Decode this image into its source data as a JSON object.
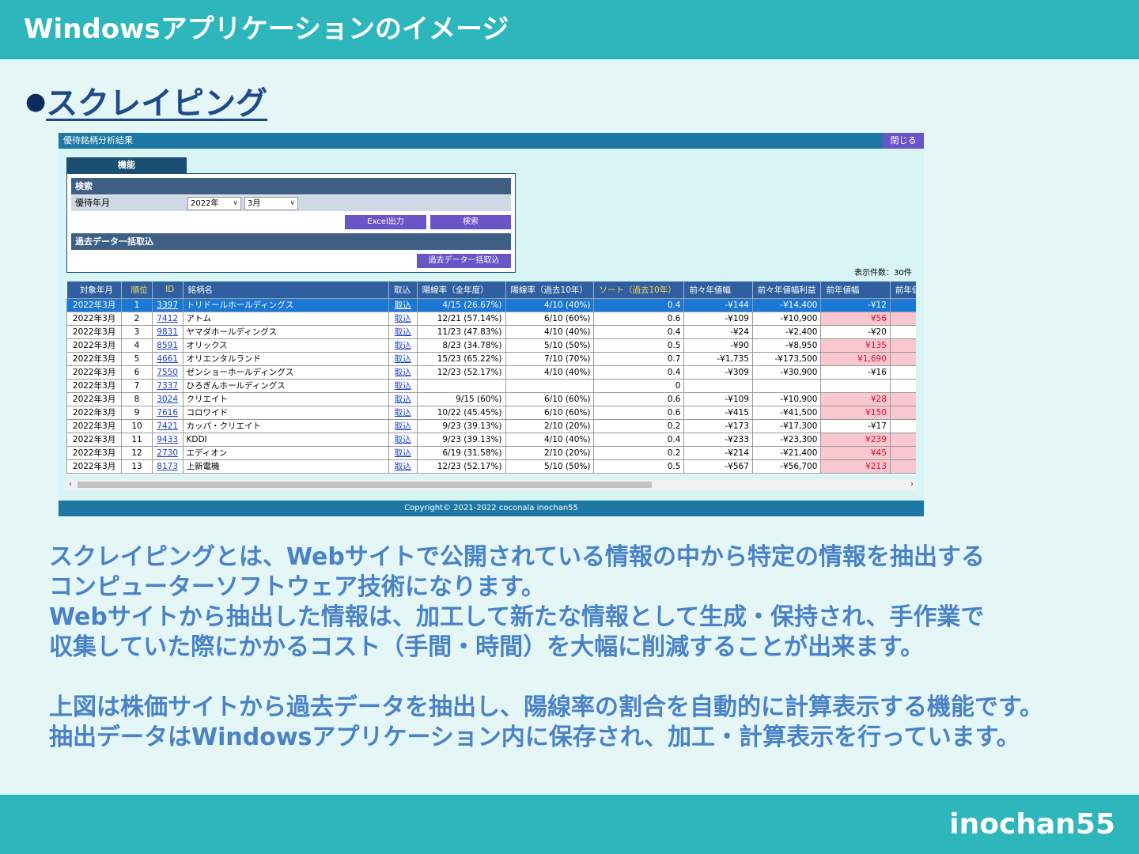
{
  "slide": {
    "header": "Windowsアプリケーションのイメージ",
    "bullet": "●",
    "section_title": "スクレイピング",
    "brand": "inochan55",
    "desc_lines": [
      "スクレイピングとは、Webサイトで公開されている情報の中から特定の情報を抽出する",
      "コンピューターソフトウェア技術になります。",
      "Webサイトから抽出した情報は、加工して新たな情報として生成・保持され、手作業で",
      "収集していた際にかかるコスト（手間・時間）を大幅に削減することが出来ます。",
      "上図は株価サイトから過去データを抽出し、陽線率の割合を自動的に計算表示する機能です。",
      "抽出データはWindowsアプリケーション内に保存され、加工・計算表示を行っています。"
    ]
  },
  "app": {
    "title": "優待銘柄分析結果",
    "close_label": "閉じる",
    "func_tab": "機能",
    "search_bar": "検索",
    "yutai_label": "優待年月",
    "year_value": "2022年",
    "month_value": "3月",
    "excel_btn": "Excel出力",
    "search_btn": "検索",
    "past_bar": "過去データ一括取込",
    "past_btn": "過去データ一括取込",
    "count": "表示件数：30件",
    "copyright": "Copyright© 2021-2022 coconala inochan55",
    "columns": [
      "対象年月",
      "順位",
      "ID",
      "銘柄名",
      "取込",
      "陽線率（全年度）",
      "陽線率（過去10年）",
      "ソート（過去10年）",
      "前々年値幅",
      "前々年値幅利益",
      "前年値幅",
      "前年値幅"
    ],
    "rows": [
      [
        "2022年3月",
        "1",
        "3397",
        "トリドールホールディングス",
        "取込",
        "4/15 (26.67%)",
        "4/10 (40%)",
        "0.4",
        "-¥144",
        "-¥14,400",
        "-¥12",
        ""
      ],
      [
        "2022年3月",
        "2",
        "7412",
        "アトム",
        "取込",
        "12/21 (57.14%)",
        "6/10 (60%)",
        "0.6",
        "-¥109",
        "-¥10,900",
        "¥56",
        ""
      ],
      [
        "2022年3月",
        "3",
        "9831",
        "ヤマダホールディングス",
        "取込",
        "11/23 (47.83%)",
        "4/10 (40%)",
        "0.4",
        "-¥24",
        "-¥2,400",
        "-¥20",
        ""
      ],
      [
        "2022年3月",
        "4",
        "8591",
        "オリックス",
        "取込",
        "8/23 (34.78%)",
        "5/10 (50%)",
        "0.5",
        "-¥90",
        "-¥8,950",
        "¥135",
        ""
      ],
      [
        "2022年3月",
        "5",
        "4661",
        "オリエンタルランド",
        "取込",
        "15/23 (65.22%)",
        "7/10 (70%)",
        "0.7",
        "-¥1,735",
        "-¥173,500",
        "¥1,690",
        "¥"
      ],
      [
        "2022年3月",
        "6",
        "7550",
        "ゼンショーホールディングス",
        "取込",
        "12/23 (52.17%)",
        "4/10 (40%)",
        "0.4",
        "-¥309",
        "-¥30,900",
        "-¥16",
        ""
      ],
      [
        "2022年3月",
        "7",
        "7337",
        "ひろぎんホールディングス",
        "取込",
        "",
        "",
        "0",
        "",
        "",
        "",
        ""
      ],
      [
        "2022年3月",
        "8",
        "3024",
        "クリエイト",
        "取込",
        "9/15 (60%)",
        "6/10 (60%)",
        "0.6",
        "-¥109",
        "-¥10,900",
        "¥28",
        ""
      ],
      [
        "2022年3月",
        "9",
        "7616",
        "コロワイド",
        "取込",
        "10/22 (45.45%)",
        "6/10 (60%)",
        "0.6",
        "-¥415",
        "-¥41,500",
        "¥150",
        ""
      ],
      [
        "2022年3月",
        "10",
        "7421",
        "カッパ・クリエイト",
        "取込",
        "9/23 (39.13%)",
        "2/10 (20%)",
        "0.2",
        "-¥173",
        "-¥17,300",
        "-¥17",
        ""
      ],
      [
        "2022年3月",
        "11",
        "9433",
        "KDDI",
        "取込",
        "9/23 (39.13%)",
        "4/10 (40%)",
        "0.4",
        "-¥233",
        "-¥23,300",
        "¥239",
        ""
      ],
      [
        "2022年3月",
        "12",
        "2730",
        "エディオン",
        "取込",
        "6/19 (31.58%)",
        "2/10 (20%)",
        "0.2",
        "-¥214",
        "-¥21,400",
        "¥45",
        ""
      ],
      [
        "2022年3月",
        "13",
        "8173",
        "上新電機",
        "取込",
        "12/23 (52.17%)",
        "5/10 (50%)",
        "0.5",
        "-¥567",
        "-¥56,700",
        "¥213",
        ""
      ]
    ]
  }
}
